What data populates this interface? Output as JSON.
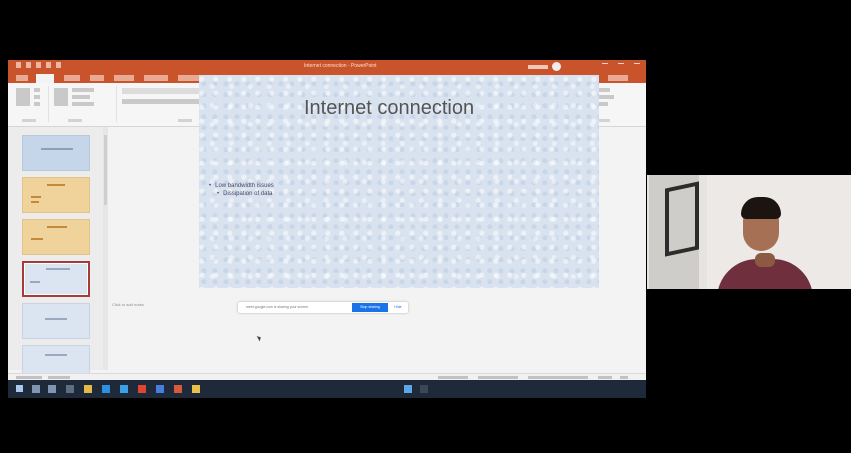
{
  "window": {
    "title": "Internet connection - PowerPoint"
  },
  "slide": {
    "title": "Internet connection",
    "bullets": [
      "Low bandwidth issues",
      "Dissipation of data"
    ]
  },
  "notes": {
    "placeholder": "Click to add notes"
  },
  "share_banner": {
    "message": "meet.google.com is sharing your screen.",
    "stop_label": "Stop sharing",
    "hide_label": "Hide"
  },
  "colors": {
    "ribbon_accent": "#c9532b",
    "slide_background": "#d9e3ef",
    "taskbar": "#1e2a3a",
    "share_button": "#1a73e8"
  },
  "icons": [
    "windows-start-icon",
    "search-icon",
    "task-view-icon",
    "file-explorer-icon",
    "powerpoint-icon",
    "chrome-icon",
    "user-camera-icon"
  ]
}
